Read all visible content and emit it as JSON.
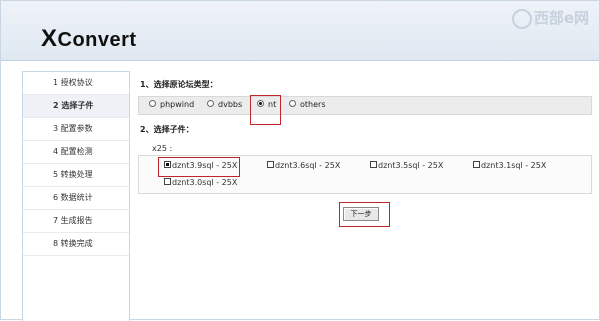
{
  "app": {
    "logo_first": "X",
    "logo_rest": "Convert",
    "watermark": "西部e网"
  },
  "sidebar": {
    "items": [
      {
        "label": "1  授权协议"
      },
      {
        "label": "2  选择子件"
      },
      {
        "label": "3  配置参数"
      },
      {
        "label": "4  配置检测"
      },
      {
        "label": "5  转换处理"
      },
      {
        "label": "6  数据统计"
      },
      {
        "label": "7  生成报告"
      },
      {
        "label": "8  转换完成"
      }
    ],
    "active_index": 1
  },
  "main": {
    "section1_title": "1、选择原论坛类型：",
    "forum_types": [
      {
        "label": "phpwind",
        "selected": false
      },
      {
        "label": "dvbbs",
        "selected": false
      },
      {
        "label": "nt",
        "selected": true
      },
      {
        "label": "others",
        "selected": false
      }
    ],
    "section2_title": "2、选择子件：",
    "group_label": "x25 :",
    "versions": [
      {
        "label": "dznt3.9sql - 25X",
        "checked": true
      },
      {
        "label": "dznt3.6sql - 25X",
        "checked": false
      },
      {
        "label": "dznt3.5sql - 25X",
        "checked": false
      },
      {
        "label": "dznt3.1sql - 25X",
        "checked": false
      },
      {
        "label": "dznt3.0sql - 25X",
        "checked": false
      }
    ],
    "next_label": "下一步"
  },
  "colors": {
    "highlight": "#c0252c",
    "header_bg": "#e6edf5"
  }
}
